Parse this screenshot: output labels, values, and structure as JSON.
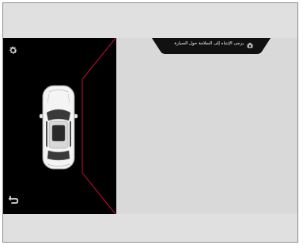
{
  "camera_view": {
    "warning_message": "يرجى الإنتباه إلى السلامة حول السيارة",
    "icons": {
      "settings": "gear-icon",
      "back": "back-arrow-icon",
      "camera": "camera-icon"
    },
    "colors": {
      "screen_background": "#000000",
      "camera_area": "#d9d9d9",
      "guide_line": "#c8102e",
      "frame": "#e0e0e0"
    }
  }
}
